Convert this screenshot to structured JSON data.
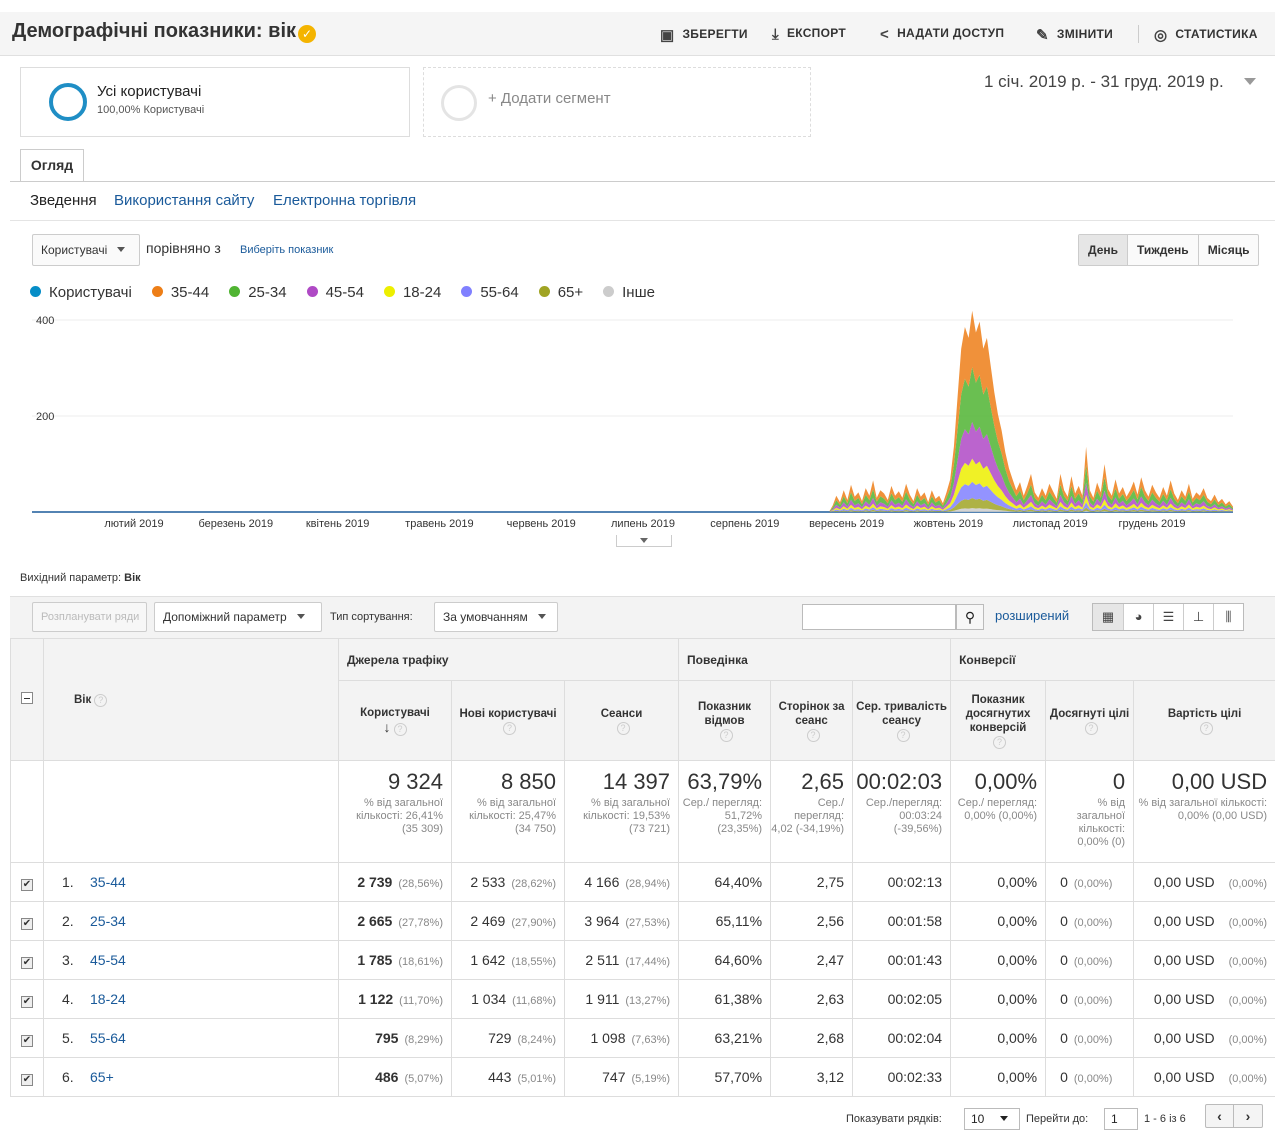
{
  "header": {
    "title": "Демографічні показники: вік",
    "actions": {
      "save": "ЗБЕРЕГТИ",
      "export": "ЕКСПОРТ",
      "share": "НАДАТИ ДОСТУП",
      "edit": "ЗМІНИТИ",
      "insights": "СТАТИСТИКА"
    }
  },
  "segments": {
    "active": {
      "name": "Усі користувачі",
      "sub": "100,00% Користувачі"
    },
    "add": "+ Додати сегмент"
  },
  "date_range": "1 січ. 2019 р. - 31 груд. 2019 р.",
  "tabs": {
    "overview": "Огляд"
  },
  "subtabs": [
    "Зведення",
    "Використання сайту",
    "Електронна торгівля"
  ],
  "chart_controls": {
    "metric": "Користувачі",
    "compare_label": "порівняно з",
    "compare_link": "Виберіть показник",
    "periods": [
      "День",
      "Тиждень",
      "Місяць"
    ]
  },
  "legend": [
    {
      "label": "Користувачі",
      "color": "#058dc7"
    },
    {
      "label": "35-44",
      "color": "#ed7e17"
    },
    {
      "label": "25-34",
      "color": "#50b432"
    },
    {
      "label": "45-54",
      "color": "#af49c5"
    },
    {
      "label": "18-24",
      "color": "#edef00"
    },
    {
      "label": "55-64",
      "color": "#8080ff"
    },
    {
      "label": "65+",
      "color": "#a0a424"
    },
    {
      "label": "Інше",
      "color": "#cccccc"
    }
  ],
  "chart_data": {
    "type": "area",
    "y_ticks": [
      "400",
      "200"
    ],
    "ylim": [
      0,
      400
    ],
    "x_tick_labels": [
      "лютий 2019",
      "березень 2019",
      "квітень 2019",
      "травень 2019",
      "червень 2019",
      "липень 2019",
      "серпень 2019",
      "вересень 2019",
      "жовтень 2019",
      "листопад 2019",
      "грудень 2019"
    ],
    "total_series": [
      0,
      0,
      0,
      0,
      0,
      0,
      0,
      0,
      0,
      0,
      0,
      0,
      0,
      0,
      0,
      0,
      0,
      0,
      0,
      0,
      0,
      0,
      0,
      0,
      0,
      0,
      0,
      0,
      0,
      0,
      0,
      0,
      0,
      0,
      0,
      0,
      0,
      0,
      0,
      0,
      0,
      0,
      0,
      0,
      0,
      0,
      0,
      0,
      0,
      0,
      0,
      0,
      0,
      0,
      0,
      0,
      0,
      0,
      0,
      0,
      0,
      0,
      0,
      0,
      0,
      0,
      0,
      0,
      0,
      0,
      0,
      0,
      0,
      0,
      0,
      0,
      0,
      0,
      0,
      0,
      0,
      0,
      0,
      0,
      0,
      0,
      0,
      0,
      0,
      0,
      0,
      0,
      0,
      0,
      0,
      0,
      0,
      0,
      0,
      0,
      0,
      0,
      0,
      0,
      0,
      0,
      0,
      0,
      0,
      0,
      0,
      0,
      0,
      0,
      0,
      0,
      0,
      0,
      0,
      0,
      0,
      0,
      0,
      0,
      0,
      0,
      0,
      0,
      0,
      0,
      0,
      0,
      0,
      0,
      0,
      0,
      0,
      0,
      0,
      0,
      0,
      0,
      0,
      0,
      0,
      0,
      0,
      0,
      0,
      0,
      0,
      0,
      0,
      0,
      0,
      0,
      0,
      0,
      0,
      0,
      0,
      0,
      0,
      0,
      0,
      0,
      0,
      0,
      0,
      0,
      0,
      0,
      0,
      0,
      0,
      0,
      0,
      0,
      0,
      0,
      0,
      0,
      0,
      0,
      0,
      0,
      0,
      0,
      0,
      0,
      0,
      0,
      0,
      0,
      0,
      0,
      0,
      0,
      0,
      0,
      0,
      0,
      0,
      0,
      0,
      0,
      0,
      0,
      0,
      0,
      0,
      0,
      0,
      0,
      0,
      0,
      0,
      0,
      12,
      30,
      18,
      40,
      22,
      50,
      28,
      36,
      20,
      44,
      30,
      58,
      26,
      40,
      34,
      22,
      48,
      30,
      38,
      26,
      52,
      32,
      20,
      44,
      28,
      36,
      18,
      40,
      24,
      30,
      16,
      36,
      60,
      120,
      210,
      300,
      340,
      320,
      370,
      330,
      350,
      300,
      320,
      270,
      220,
      180,
      150,
      110,
      80,
      60,
      40,
      55,
      30,
      48,
      70,
      36,
      26,
      44,
      30,
      52,
      38,
      24,
      70,
      40,
      28,
      66,
      34,
      48,
      30,
      120,
      40,
      26,
      54,
      36,
      88,
      42,
      30,
      60,
      34,
      46,
      28,
      40,
      56,
      32,
      64,
      40,
      28,
      50,
      36,
      26,
      46,
      30,
      58,
      34,
      22,
      40,
      28,
      52,
      24,
      36,
      30,
      44,
      26,
      20,
      32,
      18,
      24,
      14,
      20,
      10
    ],
    "series_shares": {
      "35-44": 0.2856,
      "25-34": 0.2778,
      "45-54": 0.1861,
      "18-24": 0.117,
      "55-64": 0.0829,
      "65+": 0.0507
    }
  },
  "primary_dimension": {
    "label": "Вихідний параметр:",
    "value": "Вік"
  },
  "toolbar": {
    "plot_rows": "Розпланувати ряди",
    "secondary": "Допоміжний параметр",
    "sort_label": "Тип сортування:",
    "sort_value": "За умовчанням",
    "advanced": "розширений"
  },
  "table": {
    "groups": {
      "acquisition": "Джерела трафіку",
      "behavior": "Поведінка",
      "conversions": "Конверсії"
    },
    "dimension_header": "Вік",
    "columns": [
      "Користувачі",
      "Нові користувачі",
      "Сеанси",
      "Показник відмов",
      "Сторінок за сеанс",
      "Сер. тривалість сеансу",
      "Показник досягнутих конверсій",
      "Досягнуті цілі",
      "Вартість цілі"
    ],
    "totals": [
      {
        "value": "9 324",
        "sub": "% від загальної кількості: 26,41% (35 309)"
      },
      {
        "value": "8 850",
        "sub": "% від загальної кількості: 25,47% (34 750)"
      },
      {
        "value": "14 397",
        "sub": "% від загальної кількості: 19,53% (73 721)"
      },
      {
        "value": "63,79%",
        "sub": "Сер./ перегляд: 51,72% (23,35%)"
      },
      {
        "value": "2,65",
        "sub": "Сер./ перегляд: 4,02 (-34,19%)"
      },
      {
        "value": "00:02:03",
        "sub": "Сер./перегляд: 00:03:24 (-39,56%)"
      },
      {
        "value": "0,00%",
        "sub": "Сер./ перегляд: 0,00% (0,00%)"
      },
      {
        "value": "0",
        "sub": "% від загальної кількості: 0,00% (0)"
      },
      {
        "value": "0,00 USD",
        "sub": "% від загальної кількості: 0,00% (0,00 USD)"
      }
    ],
    "rows": [
      {
        "n": "1.",
        "name": "35-44",
        "users": "2 739",
        "users_pct": "(28,56%)",
        "new": "2 533",
        "new_pct": "(28,62%)",
        "sessions": "4 166",
        "sessions_pct": "(28,94%)",
        "bounce": "64,40%",
        "pps": "2,75",
        "dur": "00:02:13",
        "conv": "0,00%",
        "goals": "0",
        "goals_pct": "(0,00%)",
        "value": "0,00 USD",
        "value_pct": "(0,00%)"
      },
      {
        "n": "2.",
        "name": "25-34",
        "users": "2 665",
        "users_pct": "(27,78%)",
        "new": "2 469",
        "new_pct": "(27,90%)",
        "sessions": "3 964",
        "sessions_pct": "(27,53%)",
        "bounce": "65,11%",
        "pps": "2,56",
        "dur": "00:01:58",
        "conv": "0,00%",
        "goals": "0",
        "goals_pct": "(0,00%)",
        "value": "0,00 USD",
        "value_pct": "(0,00%)"
      },
      {
        "n": "3.",
        "name": "45-54",
        "users": "1 785",
        "users_pct": "(18,61%)",
        "new": "1 642",
        "new_pct": "(18,55%)",
        "sessions": "2 511",
        "sessions_pct": "(17,44%)",
        "bounce": "64,60%",
        "pps": "2,47",
        "dur": "00:01:43",
        "conv": "0,00%",
        "goals": "0",
        "goals_pct": "(0,00%)",
        "value": "0,00 USD",
        "value_pct": "(0,00%)"
      },
      {
        "n": "4.",
        "name": "18-24",
        "users": "1 122",
        "users_pct": "(11,70%)",
        "new": "1 034",
        "new_pct": "(11,68%)",
        "sessions": "1 911",
        "sessions_pct": "(13,27%)",
        "bounce": "61,38%",
        "pps": "2,63",
        "dur": "00:02:05",
        "conv": "0,00%",
        "goals": "0",
        "goals_pct": "(0,00%)",
        "value": "0,00 USD",
        "value_pct": "(0,00%)"
      },
      {
        "n": "5.",
        "name": "55-64",
        "users": "795",
        "users_pct": "(8,29%)",
        "new": "729",
        "new_pct": "(8,24%)",
        "sessions": "1 098",
        "sessions_pct": "(7,63%)",
        "bounce": "63,21%",
        "pps": "2,68",
        "dur": "00:02:04",
        "conv": "0,00%",
        "goals": "0",
        "goals_pct": "(0,00%)",
        "value": "0,00 USD",
        "value_pct": "(0,00%)"
      },
      {
        "n": "6.",
        "name": "65+",
        "users": "486",
        "users_pct": "(5,07%)",
        "new": "443",
        "new_pct": "(5,01%)",
        "sessions": "747",
        "sessions_pct": "(5,19%)",
        "bounce": "57,70%",
        "pps": "3,12",
        "dur": "00:02:33",
        "conv": "0,00%",
        "goals": "0",
        "goals_pct": "(0,00%)",
        "value": "0,00 USD",
        "value_pct": "(0,00%)"
      }
    ]
  },
  "pagination": {
    "rows_label": "Показувати рядків:",
    "rows_value": "10",
    "goto_label": "Перейти до:",
    "goto_value": "1",
    "range": "1 - 6 із 6"
  }
}
